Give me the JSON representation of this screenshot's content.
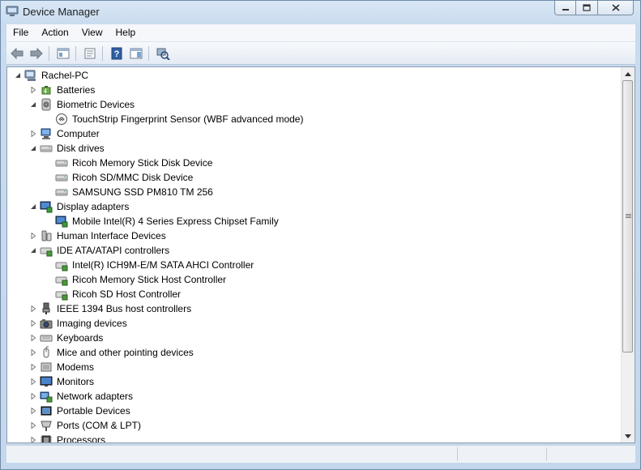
{
  "window": {
    "title": "Device Manager",
    "controls": [
      "minimize-icon",
      "maximize-icon",
      "close-icon"
    ]
  },
  "menu": [
    "File",
    "Action",
    "View",
    "Help"
  ],
  "toolbar": [
    "back-icon",
    "forward-icon",
    "show-hide-console-tree-icon",
    "properties-icon",
    "help-icon",
    "action-pane-icon",
    "scan-hardware-icon"
  ],
  "tree": [
    {
      "label": "Rachel-PC",
      "level": 0,
      "state": "expanded",
      "icon": "computer-root-icon"
    },
    {
      "label": "Batteries",
      "level": 1,
      "state": "collapsed",
      "icon": "battery-icon"
    },
    {
      "label": "Biometric Devices",
      "level": 1,
      "state": "expanded",
      "icon": "biometric-icon"
    },
    {
      "label": "TouchStrip Fingerprint Sensor (WBF advanced mode)",
      "level": 2,
      "state": "leaf",
      "icon": "fingerprint-icon"
    },
    {
      "label": "Computer",
      "level": 1,
      "state": "collapsed",
      "icon": "computer-icon"
    },
    {
      "label": "Disk drives",
      "level": 1,
      "state": "expanded",
      "icon": "disk-drive-icon"
    },
    {
      "label": "Ricoh Memory Stick Disk Device",
      "level": 2,
      "state": "leaf",
      "icon": "disk-drive-icon"
    },
    {
      "label": "Ricoh SD/MMC Disk Device",
      "level": 2,
      "state": "leaf",
      "icon": "disk-drive-icon"
    },
    {
      "label": "SAMSUNG SSD PM810 TM 256",
      "level": 2,
      "state": "leaf",
      "icon": "disk-drive-icon"
    },
    {
      "label": "Display adapters",
      "level": 1,
      "state": "expanded",
      "icon": "display-adapter-icon"
    },
    {
      "label": "Mobile Intel(R) 4 Series Express Chipset Family",
      "level": 2,
      "state": "leaf",
      "icon": "display-adapter-icon"
    },
    {
      "label": "Human Interface Devices",
      "level": 1,
      "state": "collapsed",
      "icon": "hid-icon"
    },
    {
      "label": "IDE ATA/ATAPI controllers",
      "level": 1,
      "state": "expanded",
      "icon": "ide-controller-icon"
    },
    {
      "label": "Intel(R) ICH9M-E/M SATA AHCI Controller",
      "level": 2,
      "state": "leaf",
      "icon": "ide-controller-icon"
    },
    {
      "label": "Ricoh Memory Stick Host Controller",
      "level": 2,
      "state": "leaf",
      "icon": "ide-controller-icon"
    },
    {
      "label": "Ricoh SD Host Controller",
      "level": 2,
      "state": "leaf",
      "icon": "ide-controller-icon"
    },
    {
      "label": "IEEE 1394 Bus host controllers",
      "level": 1,
      "state": "collapsed",
      "icon": "ieee1394-icon"
    },
    {
      "label": "Imaging devices",
      "level": 1,
      "state": "collapsed",
      "icon": "camera-icon"
    },
    {
      "label": "Keyboards",
      "level": 1,
      "state": "collapsed",
      "icon": "keyboard-icon"
    },
    {
      "label": "Mice and other pointing devices",
      "level": 1,
      "state": "collapsed",
      "icon": "mouse-icon"
    },
    {
      "label": "Modems",
      "level": 1,
      "state": "collapsed",
      "icon": "modem-icon"
    },
    {
      "label": "Monitors",
      "level": 1,
      "state": "collapsed",
      "icon": "monitor-icon"
    },
    {
      "label": "Network adapters",
      "level": 1,
      "state": "collapsed",
      "icon": "network-adapter-icon"
    },
    {
      "label": "Portable Devices",
      "level": 1,
      "state": "collapsed",
      "icon": "portable-device-icon"
    },
    {
      "label": "Ports (COM & LPT)",
      "level": 1,
      "state": "collapsed",
      "icon": "port-icon"
    },
    {
      "label": "Processors",
      "level": 1,
      "state": "collapsed",
      "icon": "processor-icon"
    }
  ],
  "scrollbar": {
    "position_fraction": 0.0,
    "visible_fraction": 0.78
  }
}
